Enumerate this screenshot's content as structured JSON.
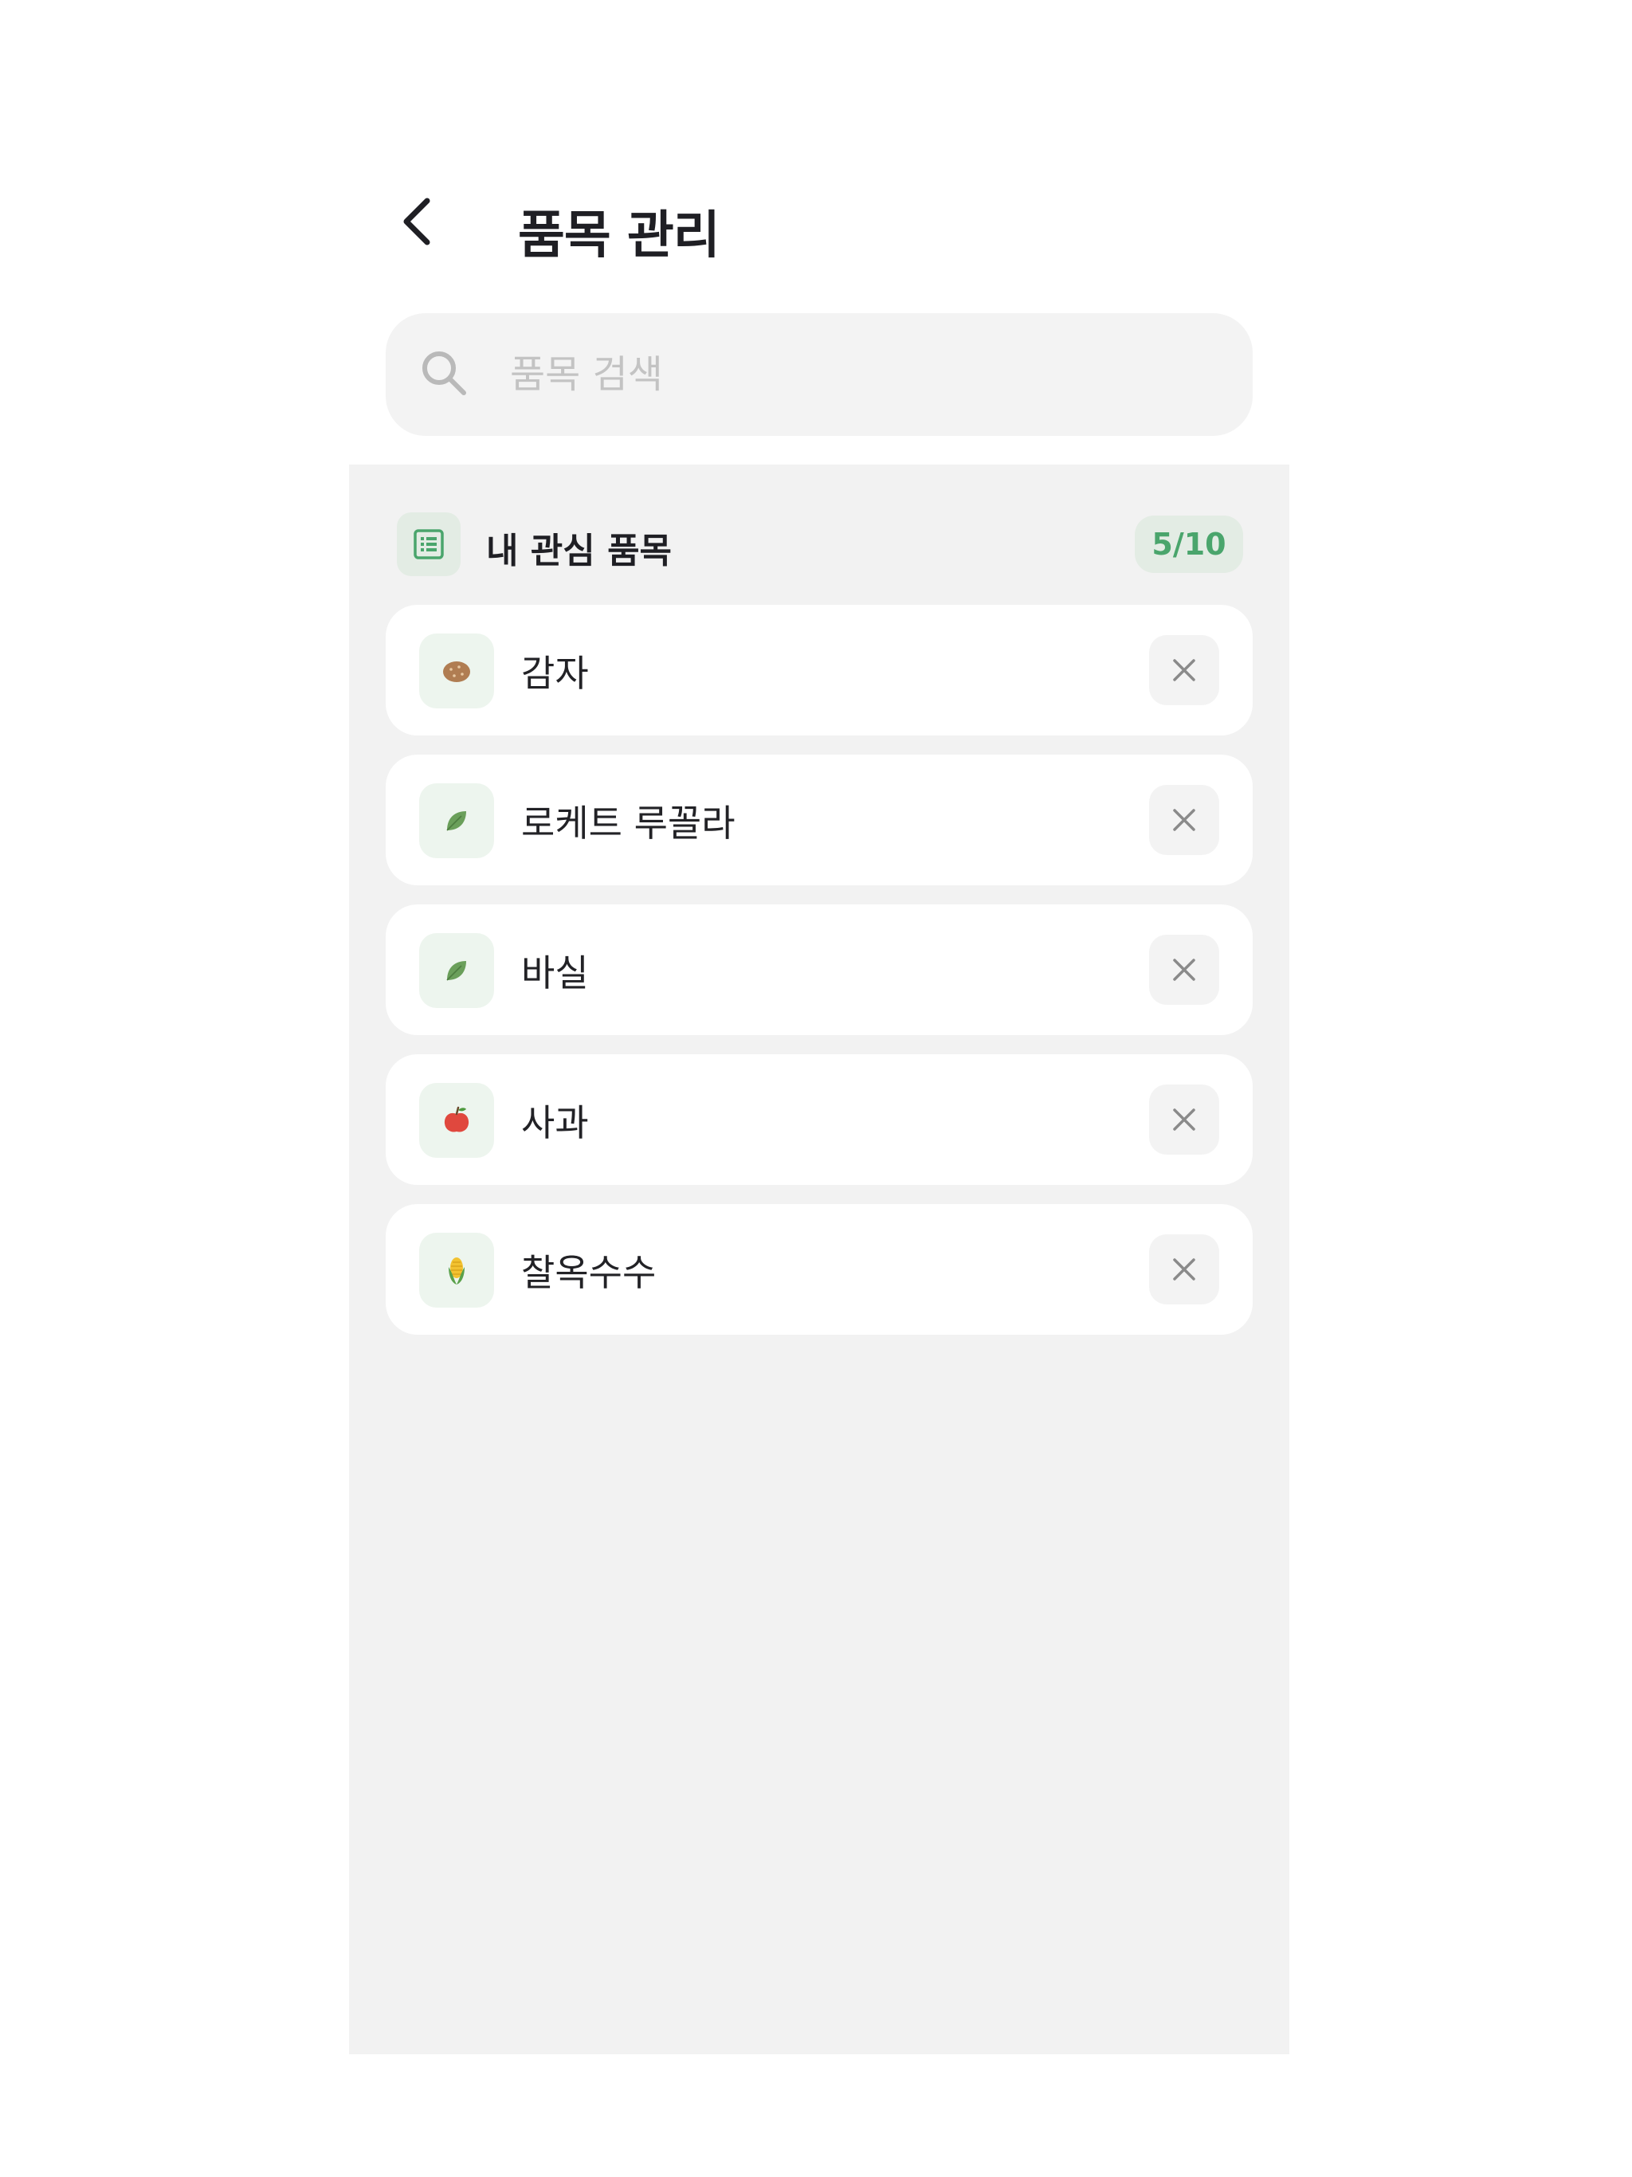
{
  "header": {
    "title": "품목 관리",
    "back_icon": "chevron-left-icon"
  },
  "search": {
    "placeholder": "품목 검색",
    "value": "",
    "icon": "search-icon"
  },
  "favorites": {
    "title": "내 관심 품목",
    "count_label": "5/10",
    "icon": "list-icon",
    "items": [
      {
        "name": "감자",
        "icon": "potato-icon"
      },
      {
        "name": "로케트 루꼴라",
        "icon": "leaf-icon"
      },
      {
        "name": "바실",
        "icon": "leaf-icon"
      },
      {
        "name": "사과",
        "icon": "apple-icon"
      },
      {
        "name": "찰옥수수",
        "icon": "corn-icon"
      }
    ]
  },
  "colors": {
    "accent_green": "#4aa56c",
    "badge_bg": "#e3ece4",
    "panel_bg": "#f2f2f2",
    "search_bg": "#f3f3f3"
  }
}
